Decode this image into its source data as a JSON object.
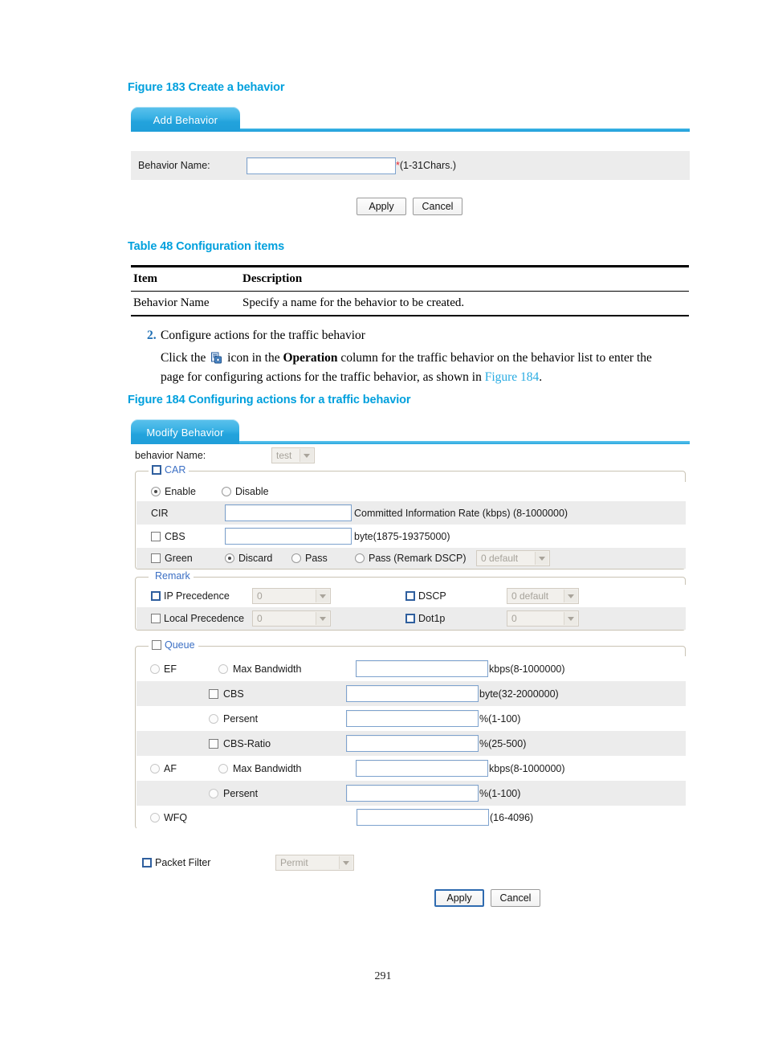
{
  "document": {
    "page_number": "291",
    "figure_183": {
      "caption": "Figure 183 Create a behavior"
    },
    "table_48": {
      "caption": "Table 48 Configuration items",
      "columns": [
        "Item",
        "Description"
      ],
      "rows": [
        {
          "item": "Behavior Name",
          "description": "Specify a name for the behavior to be created."
        }
      ]
    },
    "step_2": {
      "marker": "2.",
      "title": "Configure actions for the traffic behavior",
      "body_part1": "Click the ",
      "icon_name": "operation-modify-icon",
      "body_part2": " icon in the ",
      "body_bold": "Operation",
      "body_part3": " column for the traffic behavior on the behavior list to enter the",
      "body_line2_part1": "page for configuring actions for the traffic behavior, as shown in ",
      "body_line2_link": "Figure 184",
      "body_line2_end": "."
    },
    "figure_184": {
      "caption": "Figure 184 Configuring actions for a traffic behavior"
    }
  },
  "add_behavior_ui": {
    "tab_label": "Add Behavior",
    "behavior_name_label": "Behavior Name:",
    "behavior_name_value": "",
    "behavior_name_star": "*",
    "behavior_name_hint": "(1-31Chars.)",
    "apply_label": "Apply",
    "cancel_label": "Cancel"
  },
  "modify_behavior_ui": {
    "tab_label": "Modify Behavior",
    "behavior_name_label": "behavior Name:",
    "behavior_name_select_value": "test",
    "car": {
      "legend": "CAR",
      "enable_label": "Enable",
      "disable_label": "Disable",
      "enable_selected": true,
      "cir_label": "CIR",
      "cir_value": "",
      "cir_hint": "Committed Information Rate (kbps) (8-1000000)",
      "cbs_label": "CBS",
      "cbs_value": "",
      "cbs_hint": "byte(1875-19375000)",
      "green_label": "Green",
      "green_options": [
        "Discard",
        "Pass",
        "Pass (Remark DSCP)"
      ],
      "green_selected": "Discard",
      "green_dscp_value": "0 default"
    },
    "remark": {
      "legend": "Remark",
      "ip_precedence_label": "IP Precedence",
      "ip_precedence_value": "0",
      "dscp_label": "DSCP",
      "dscp_value": "0 default",
      "local_precedence_label": "Local Precedence",
      "local_precedence_value": "0",
      "dot1p_label": "Dot1p",
      "dot1p_value": "0"
    },
    "queue": {
      "legend": "Queue",
      "ef_label": "EF",
      "af_label": "AF",
      "wfq_label": "WFQ",
      "rows": [
        {
          "label": "Max Bandwidth",
          "control": "radio",
          "value": "",
          "hint": "kbps(8-1000000)"
        },
        {
          "label": "CBS",
          "control": "checkbox",
          "value": "",
          "hint": "byte(32-2000000)"
        },
        {
          "label": "Persent",
          "control": "radio",
          "value": "",
          "hint": "%(1-100)"
        },
        {
          "label": "CBS-Ratio",
          "control": "checkbox",
          "value": "",
          "hint": "%(25-500)"
        },
        {
          "label": "Max Bandwidth",
          "control": "radio",
          "value": "",
          "hint": "kbps(8-1000000)"
        },
        {
          "label": "Persent",
          "control": "radio",
          "value": "",
          "hint": "%(1-100)"
        },
        {
          "label": "",
          "control": "none",
          "value": "",
          "hint": "(16-4096)"
        }
      ]
    },
    "packet_filter": {
      "label": "Packet Filter",
      "select_value": "Permit"
    },
    "apply_label": "Apply",
    "cancel_label": "Cancel"
  }
}
